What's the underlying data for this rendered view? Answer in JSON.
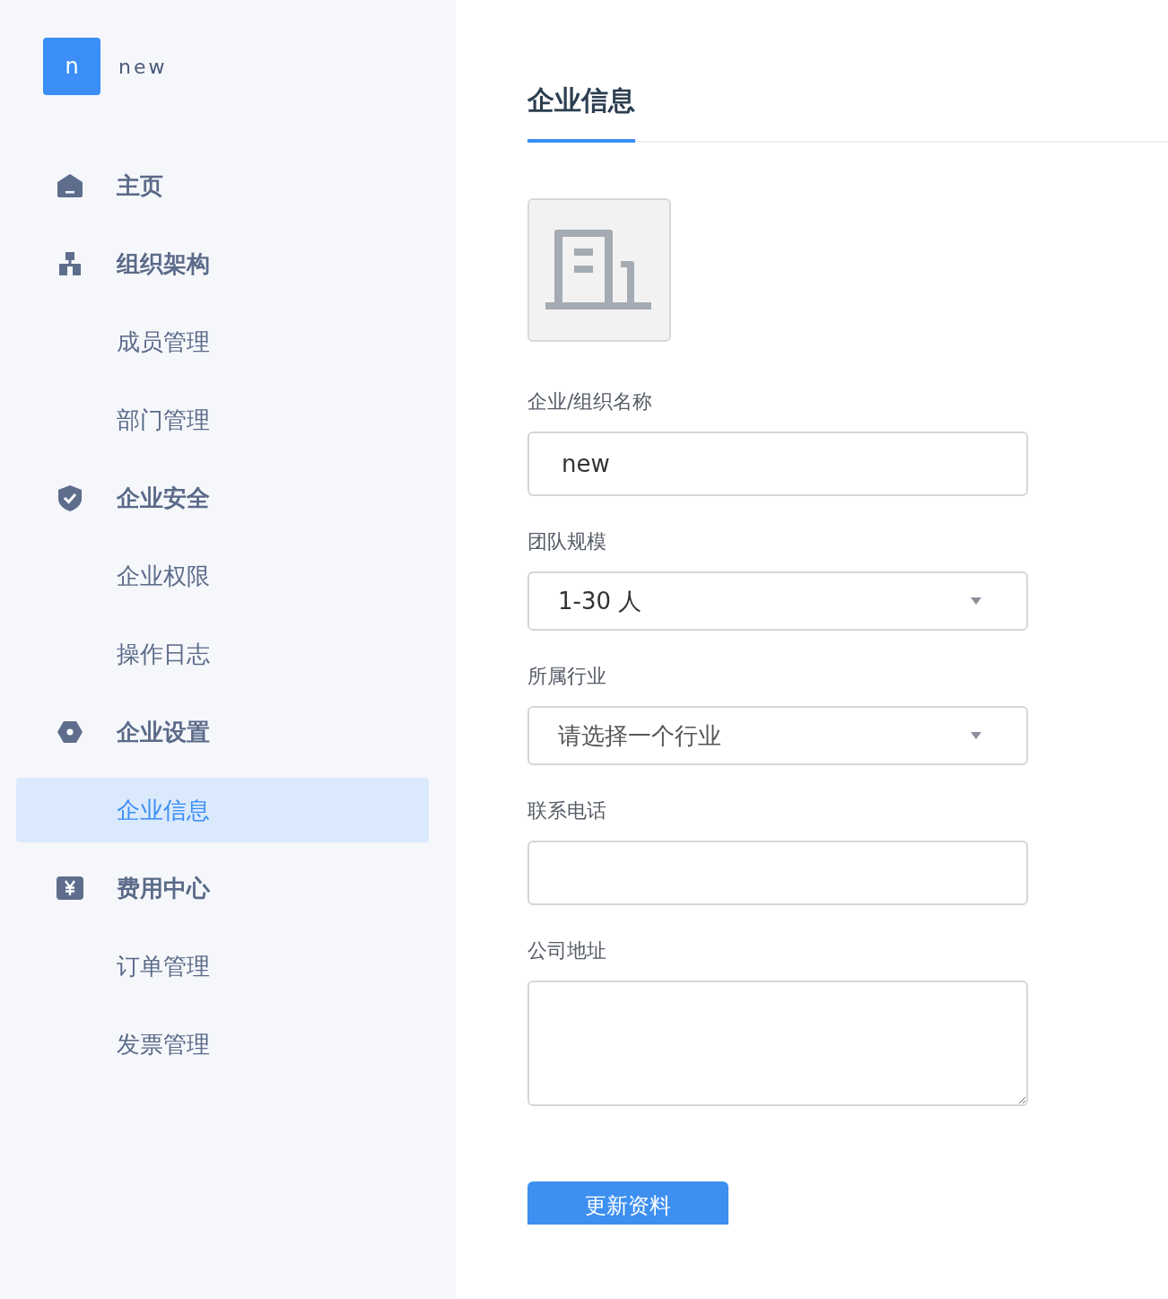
{
  "brand": {
    "initial": "n",
    "name": "new"
  },
  "nav": [
    {
      "label": "主页",
      "kind": "home",
      "selected": false
    },
    {
      "label": "组织架构",
      "kind": "org",
      "selected": false,
      "children": [
        {
          "label": "成员管理",
          "selected": false
        },
        {
          "label": "部门管理",
          "selected": false
        }
      ]
    },
    {
      "label": "企业安全",
      "kind": "shield",
      "selected": false,
      "children": [
        {
          "label": "企业权限",
          "selected": false
        },
        {
          "label": "操作日志",
          "selected": false
        }
      ]
    },
    {
      "label": "企业设置",
      "kind": "hexagon",
      "selected": false,
      "children": [
        {
          "label": "企业信息",
          "selected": true
        }
      ]
    },
    {
      "label": "费用中心",
      "kind": "yen",
      "selected": false,
      "children": [
        {
          "label": "订单管理",
          "selected": false
        },
        {
          "label": "发票管理",
          "selected": false
        }
      ]
    }
  ],
  "tabs": [
    {
      "label": "企业信息",
      "selected": true
    }
  ],
  "form": {
    "logo": {
      "kind": "building"
    },
    "fields": [
      {
        "kind": "input",
        "label": "企业/组织名称",
        "value": "new"
      },
      {
        "kind": "select",
        "label": "团队规模",
        "value": "1-30 人"
      },
      {
        "kind": "select",
        "label": "所属行业",
        "placeholder": "请选择一个行业"
      },
      {
        "kind": "input",
        "label": "联系电话"
      },
      {
        "kind": "textarea",
        "label": "公司地址"
      }
    ],
    "submit": "更新资料"
  }
}
